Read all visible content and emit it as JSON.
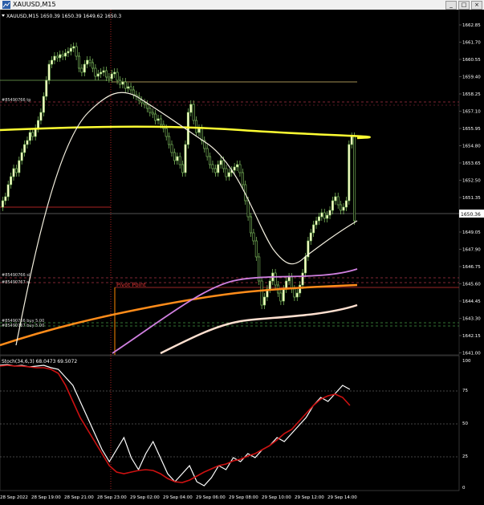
{
  "window": {
    "title": "XAUUSD,M15"
  },
  "chart": {
    "header": "XAUUSD,M15  1650.39 1650.39 1649.62 1650.3",
    "price_axis": [
      "1662.85",
      "1661.70",
      "1660.55",
      "1659.40",
      "1658.25",
      "1657.10",
      "1655.95",
      "1654.80",
      "1653.65",
      "1652.50",
      "1651.35",
      "1650.20",
      "1649.05",
      "1647.90",
      "1646.75",
      "1645.60",
      "1644.45",
      "1643.30",
      "1642.15",
      "1641.00"
    ],
    "current_price": "1650.36",
    "pivot_label": "Pivot Point",
    "orders": [
      "#85490766 tp",
      "#85490766 sl",
      "#85490767 sl",
      "#85490766 buy 5.00",
      "#85490767 buy 5.00"
    ],
    "stoch_label": "Stoch(34,6,3) 68.0473 69.5072",
    "stoch_axis": [
      "100",
      "75",
      "50",
      "25",
      "0"
    ],
    "time_axis": [
      "28 Sep 2022",
      "28 Sep 19:00",
      "28 Sep 21:00",
      "28 Sep 23:00",
      "29 Sep 02:00",
      "29 Sep 04:00",
      "29 Sep 06:00",
      "29 Sep 08:00",
      "29 Sep 10:00",
      "29 Sep 12:00",
      "29 Sep 14:00"
    ]
  }
}
